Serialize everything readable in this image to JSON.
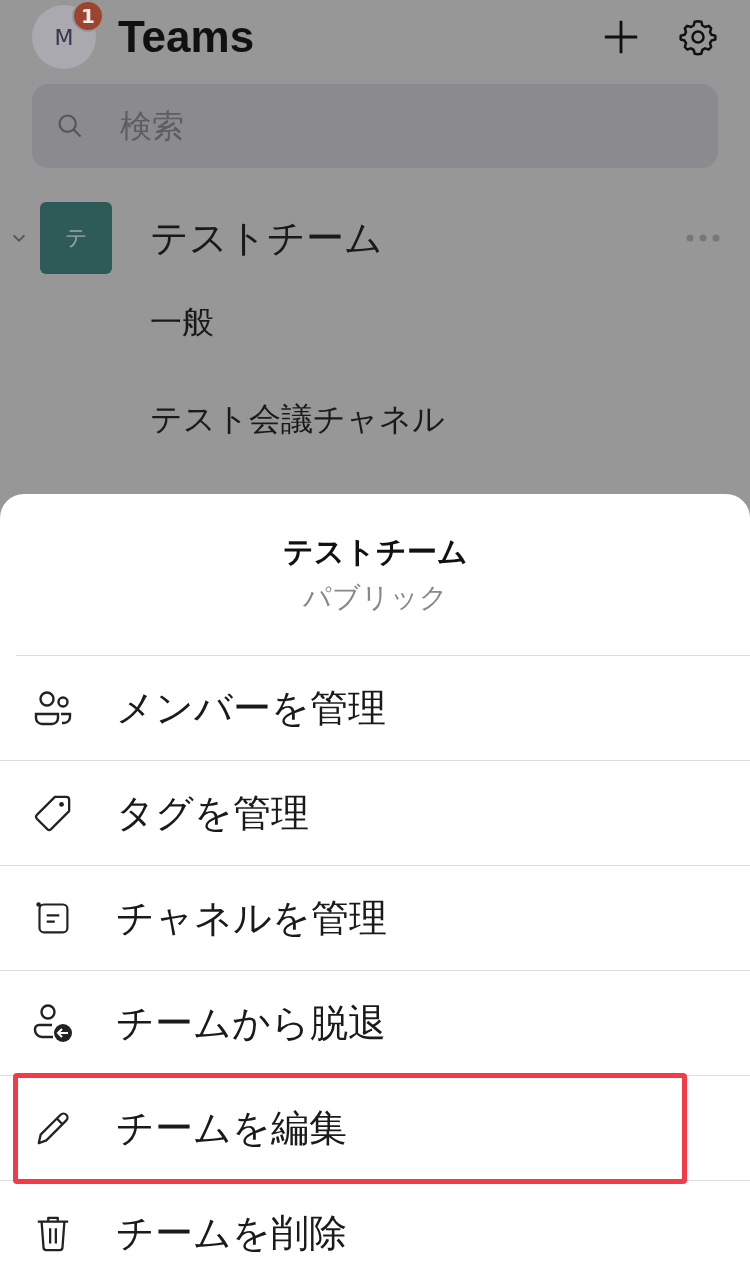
{
  "header": {
    "avatar": "M",
    "badge": "1",
    "title": "Teams"
  },
  "search": {
    "placeholder": "検索"
  },
  "team": {
    "initial": "テ",
    "name": "テストチーム",
    "expanded": true,
    "channels": [
      "一般",
      "テスト会議チャネル"
    ]
  },
  "sheet": {
    "title": "テストチーム",
    "subtitle": "パブリック",
    "items": [
      {
        "label": "メンバーを管理",
        "highlighted": false
      },
      {
        "label": "タグを管理",
        "highlighted": false
      },
      {
        "label": "チャネルを管理",
        "highlighted": false
      },
      {
        "label": "チームから脱退",
        "highlighted": false
      },
      {
        "label": "チームを編集",
        "highlighted": true
      },
      {
        "label": "チームを削除",
        "highlighted": false
      }
    ]
  }
}
